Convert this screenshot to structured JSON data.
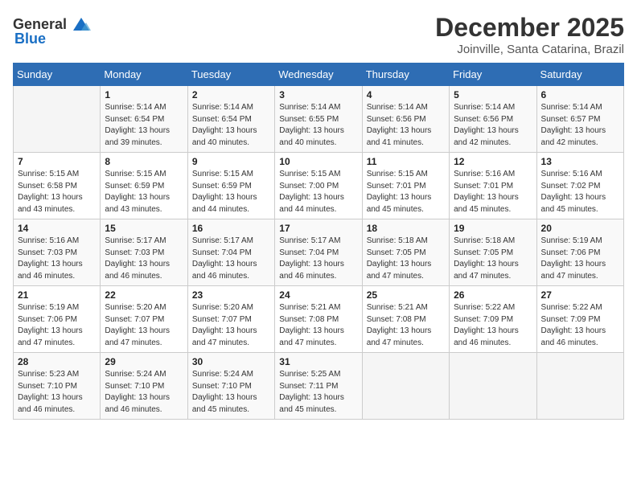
{
  "header": {
    "logo_general": "General",
    "logo_blue": "Blue",
    "month": "December 2025",
    "location": "Joinville, Santa Catarina, Brazil"
  },
  "days_of_week": [
    "Sunday",
    "Monday",
    "Tuesday",
    "Wednesday",
    "Thursday",
    "Friday",
    "Saturday"
  ],
  "weeks": [
    [
      {
        "day": "",
        "sunrise": "",
        "sunset": "",
        "daylight": ""
      },
      {
        "day": "1",
        "sunrise": "5:14 AM",
        "sunset": "6:54 PM",
        "daylight": "13 hours and 39 minutes."
      },
      {
        "day": "2",
        "sunrise": "5:14 AM",
        "sunset": "6:54 PM",
        "daylight": "13 hours and 40 minutes."
      },
      {
        "day": "3",
        "sunrise": "5:14 AM",
        "sunset": "6:55 PM",
        "daylight": "13 hours and 40 minutes."
      },
      {
        "day": "4",
        "sunrise": "5:14 AM",
        "sunset": "6:56 PM",
        "daylight": "13 hours and 41 minutes."
      },
      {
        "day": "5",
        "sunrise": "5:14 AM",
        "sunset": "6:56 PM",
        "daylight": "13 hours and 42 minutes."
      },
      {
        "day": "6",
        "sunrise": "5:14 AM",
        "sunset": "6:57 PM",
        "daylight": "13 hours and 42 minutes."
      }
    ],
    [
      {
        "day": "7",
        "sunrise": "5:15 AM",
        "sunset": "6:58 PM",
        "daylight": "13 hours and 43 minutes."
      },
      {
        "day": "8",
        "sunrise": "5:15 AM",
        "sunset": "6:59 PM",
        "daylight": "13 hours and 43 minutes."
      },
      {
        "day": "9",
        "sunrise": "5:15 AM",
        "sunset": "6:59 PM",
        "daylight": "13 hours and 44 minutes."
      },
      {
        "day": "10",
        "sunrise": "5:15 AM",
        "sunset": "7:00 PM",
        "daylight": "13 hours and 44 minutes."
      },
      {
        "day": "11",
        "sunrise": "5:15 AM",
        "sunset": "7:01 PM",
        "daylight": "13 hours and 45 minutes."
      },
      {
        "day": "12",
        "sunrise": "5:16 AM",
        "sunset": "7:01 PM",
        "daylight": "13 hours and 45 minutes."
      },
      {
        "day": "13",
        "sunrise": "5:16 AM",
        "sunset": "7:02 PM",
        "daylight": "13 hours and 45 minutes."
      }
    ],
    [
      {
        "day": "14",
        "sunrise": "5:16 AM",
        "sunset": "7:03 PM",
        "daylight": "13 hours and 46 minutes."
      },
      {
        "day": "15",
        "sunrise": "5:17 AM",
        "sunset": "7:03 PM",
        "daylight": "13 hours and 46 minutes."
      },
      {
        "day": "16",
        "sunrise": "5:17 AM",
        "sunset": "7:04 PM",
        "daylight": "13 hours and 46 minutes."
      },
      {
        "day": "17",
        "sunrise": "5:17 AM",
        "sunset": "7:04 PM",
        "daylight": "13 hours and 46 minutes."
      },
      {
        "day": "18",
        "sunrise": "5:18 AM",
        "sunset": "7:05 PM",
        "daylight": "13 hours and 47 minutes."
      },
      {
        "day": "19",
        "sunrise": "5:18 AM",
        "sunset": "7:05 PM",
        "daylight": "13 hours and 47 minutes."
      },
      {
        "day": "20",
        "sunrise": "5:19 AM",
        "sunset": "7:06 PM",
        "daylight": "13 hours and 47 minutes."
      }
    ],
    [
      {
        "day": "21",
        "sunrise": "5:19 AM",
        "sunset": "7:06 PM",
        "daylight": "13 hours and 47 minutes."
      },
      {
        "day": "22",
        "sunrise": "5:20 AM",
        "sunset": "7:07 PM",
        "daylight": "13 hours and 47 minutes."
      },
      {
        "day": "23",
        "sunrise": "5:20 AM",
        "sunset": "7:07 PM",
        "daylight": "13 hours and 47 minutes."
      },
      {
        "day": "24",
        "sunrise": "5:21 AM",
        "sunset": "7:08 PM",
        "daylight": "13 hours and 47 minutes."
      },
      {
        "day": "25",
        "sunrise": "5:21 AM",
        "sunset": "7:08 PM",
        "daylight": "13 hours and 47 minutes."
      },
      {
        "day": "26",
        "sunrise": "5:22 AM",
        "sunset": "7:09 PM",
        "daylight": "13 hours and 46 minutes."
      },
      {
        "day": "27",
        "sunrise": "5:22 AM",
        "sunset": "7:09 PM",
        "daylight": "13 hours and 46 minutes."
      }
    ],
    [
      {
        "day": "28",
        "sunrise": "5:23 AM",
        "sunset": "7:10 PM",
        "daylight": "13 hours and 46 minutes."
      },
      {
        "day": "29",
        "sunrise": "5:24 AM",
        "sunset": "7:10 PM",
        "daylight": "13 hours and 46 minutes."
      },
      {
        "day": "30",
        "sunrise": "5:24 AM",
        "sunset": "7:10 PM",
        "daylight": "13 hours and 45 minutes."
      },
      {
        "day": "31",
        "sunrise": "5:25 AM",
        "sunset": "7:11 PM",
        "daylight": "13 hours and 45 minutes."
      },
      {
        "day": "",
        "sunrise": "",
        "sunset": "",
        "daylight": ""
      },
      {
        "day": "",
        "sunrise": "",
        "sunset": "",
        "daylight": ""
      },
      {
        "day": "",
        "sunrise": "",
        "sunset": "",
        "daylight": ""
      }
    ]
  ],
  "labels": {
    "sunrise_prefix": "Sunrise: ",
    "sunset_prefix": "Sunset: ",
    "daylight_prefix": "Daylight: "
  }
}
